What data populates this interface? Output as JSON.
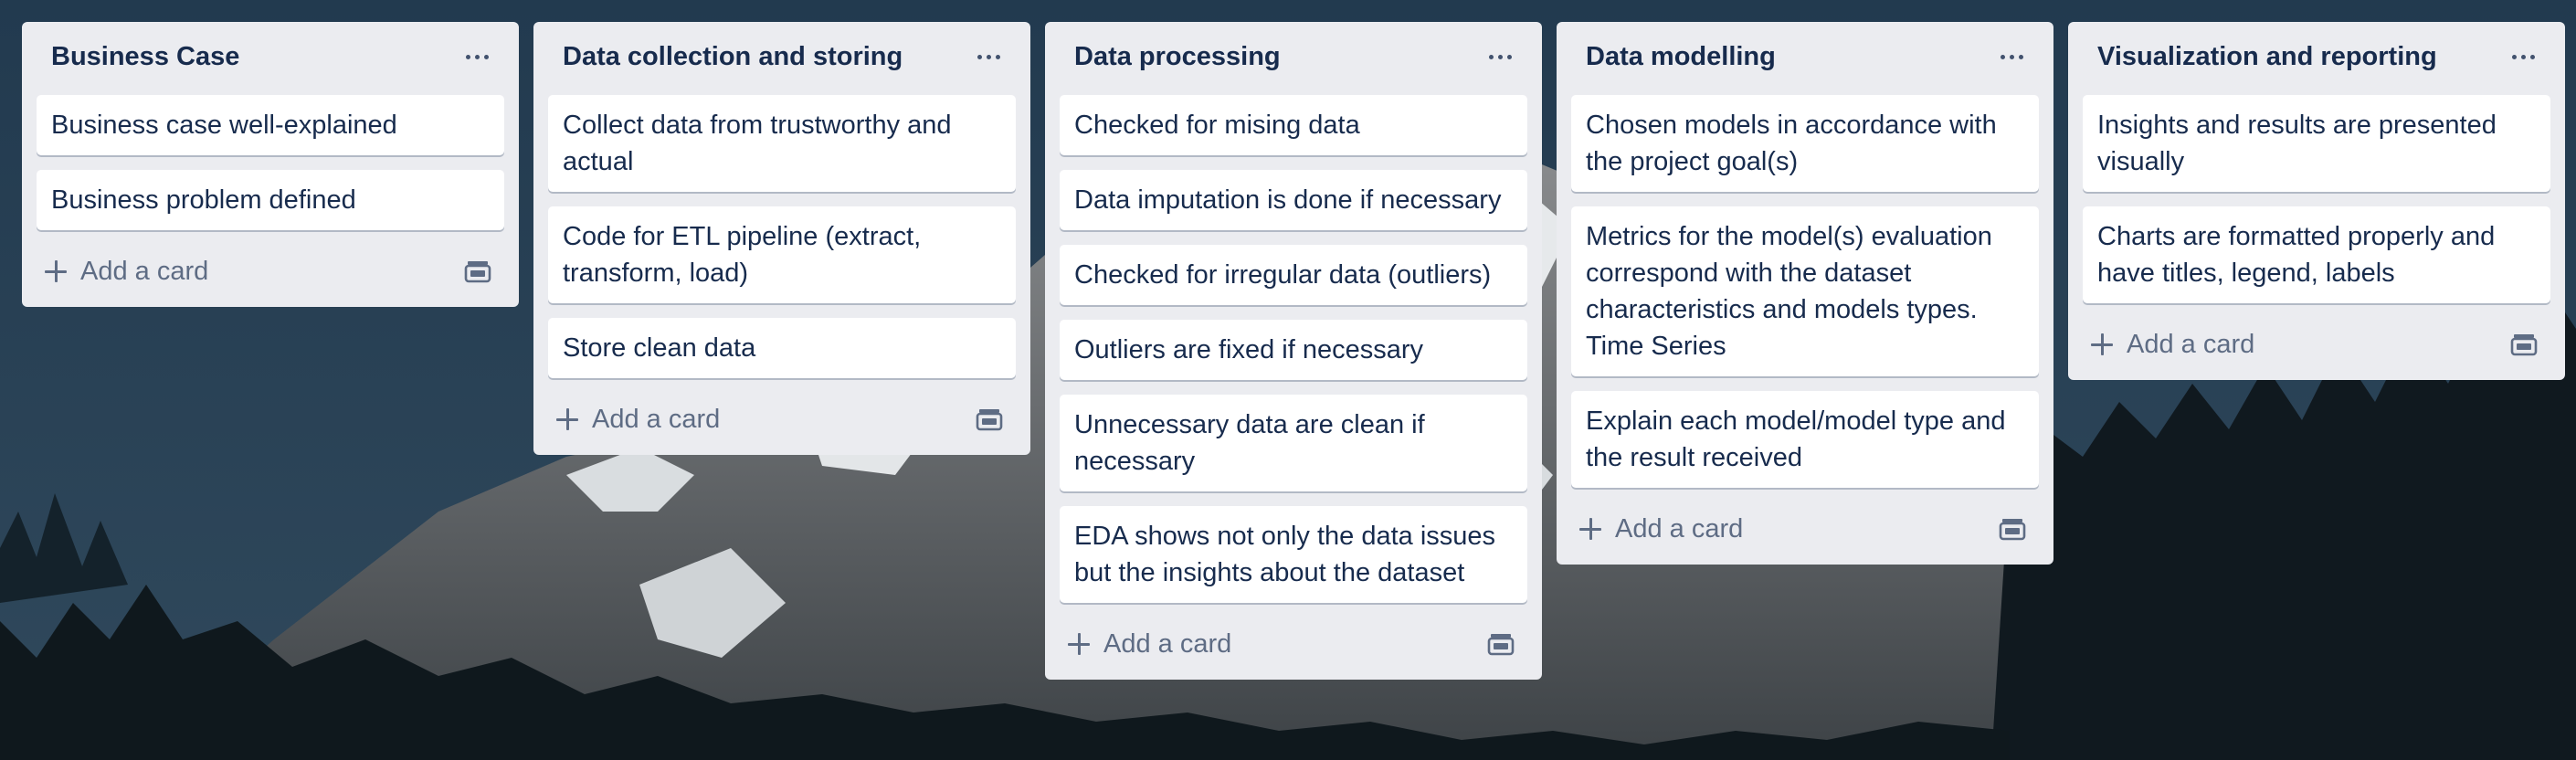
{
  "lists": [
    {
      "title": "Business Case",
      "cards": [
        "Business case well-explained",
        "Business problem defined"
      ],
      "add_card_label": "Add a card"
    },
    {
      "title": "Data collection and storing",
      "cards": [
        "Collect data from trustworthy and actual",
        "Code for ETL pipeline (extract, transform, load)",
        "Store clean data"
      ],
      "add_card_label": "Add a card"
    },
    {
      "title": "Data processing",
      "cards": [
        "Checked for mising data",
        "Data imputation is done if necessary",
        "Checked for irregular data (outliers)",
        "Outliers are fixed if necessary",
        "Unnecessary data are clean if necessary",
        "EDA shows not only the data issues but the insights about the dataset"
      ],
      "add_card_label": "Add a card"
    },
    {
      "title": "Data modelling",
      "cards": [
        "Chosen models in accordance with the project goal(s)",
        "Metrics for the model(s) evaluation correspond with the dataset characteristics and models types. Time Series",
        "Explain each model/model type and the result received"
      ],
      "add_card_label": "Add a card"
    },
    {
      "title": "Visualization and reporting",
      "cards": [
        "Insights and results are presented visually",
        "Charts are formatted properly and have titles, legend, labels"
      ],
      "add_card_label": "Add a card"
    }
  ],
  "icons": {
    "list_menu": "more-horizontal-icon",
    "add": "plus-icon",
    "template": "card-template-icon"
  },
  "colors": {
    "list_bg": "#ebecf0",
    "card_bg": "#ffffff",
    "text": "#172b4d",
    "muted": "#5e6c84"
  }
}
